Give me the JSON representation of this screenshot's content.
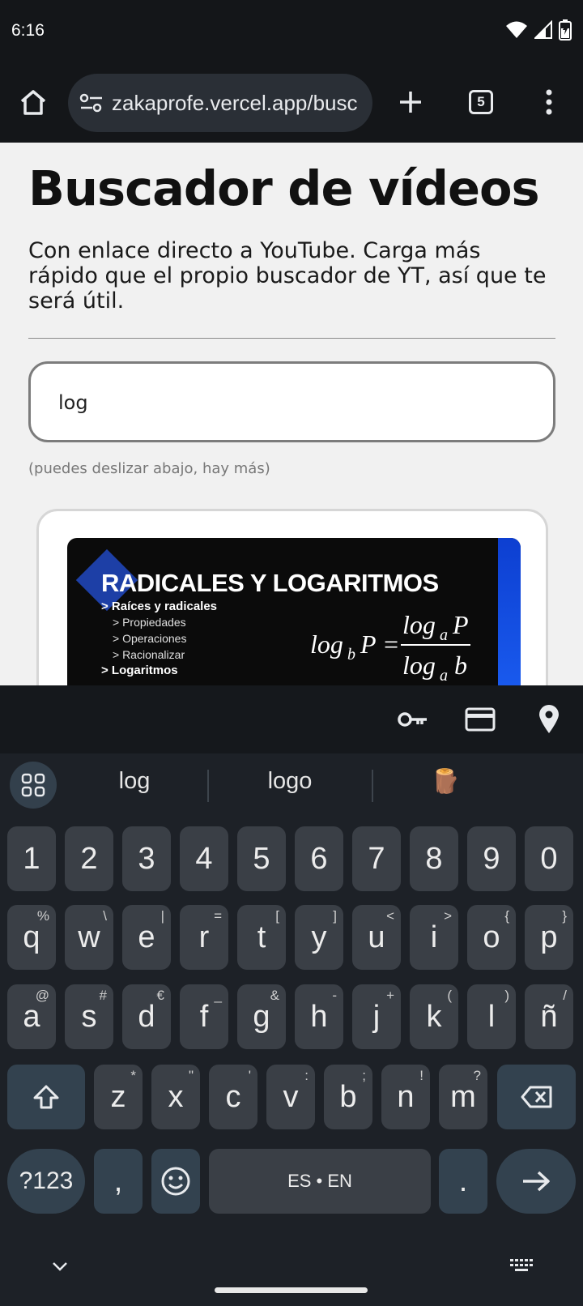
{
  "status_bar": {
    "time": "6:16"
  },
  "browser": {
    "url": "zakaprofe.vercel.app/busc",
    "tab_count": "5"
  },
  "page": {
    "title": "Buscador de vídeos",
    "lead": "Con enlace directo a YouTube. Carga más rápido que el propio buscador de YT, así que te será útil.",
    "search_value": "log",
    "hint": "(puedes deslizar abajo, hay más)",
    "result": {
      "thumb_title": "RADICALES Y LOGARITMOS",
      "line1": "> Raíces y radicales",
      "sub1": "> Propiedades",
      "sub2": "> Operaciones",
      "sub3": "> Racionalizar",
      "line2": "> Logaritmos"
    }
  },
  "keyboard": {
    "suggestions": [
      "log",
      "logo",
      "🪵"
    ],
    "numbers": [
      "1",
      "2",
      "3",
      "4",
      "5",
      "6",
      "7",
      "8",
      "9",
      "0"
    ],
    "row1": [
      [
        "q",
        "%"
      ],
      [
        "w",
        "\\"
      ],
      [
        "e",
        "|"
      ],
      [
        "r",
        "="
      ],
      [
        "t",
        "["
      ],
      [
        "y",
        "]"
      ],
      [
        "u",
        "<"
      ],
      [
        "i",
        ">"
      ],
      [
        "o",
        "{"
      ],
      [
        "p",
        "}"
      ]
    ],
    "row2": [
      [
        "a",
        "@"
      ],
      [
        "s",
        "#"
      ],
      [
        "d",
        "€"
      ],
      [
        "f",
        "_"
      ],
      [
        "g",
        "&"
      ],
      [
        "h",
        "-"
      ],
      [
        "j",
        "+"
      ],
      [
        "k",
        "("
      ],
      [
        "l",
        ")"
      ],
      [
        "ñ",
        "/"
      ]
    ],
    "row3": [
      [
        "z",
        "*"
      ],
      [
        "x",
        "\""
      ],
      [
        "c",
        "'"
      ],
      [
        "v",
        ":"
      ],
      [
        "b",
        ";"
      ],
      [
        "n",
        "!"
      ],
      [
        "m",
        "?"
      ]
    ],
    "symbols_label": "?123",
    "comma": ",",
    "space_label": "ES • EN",
    "period": "."
  }
}
